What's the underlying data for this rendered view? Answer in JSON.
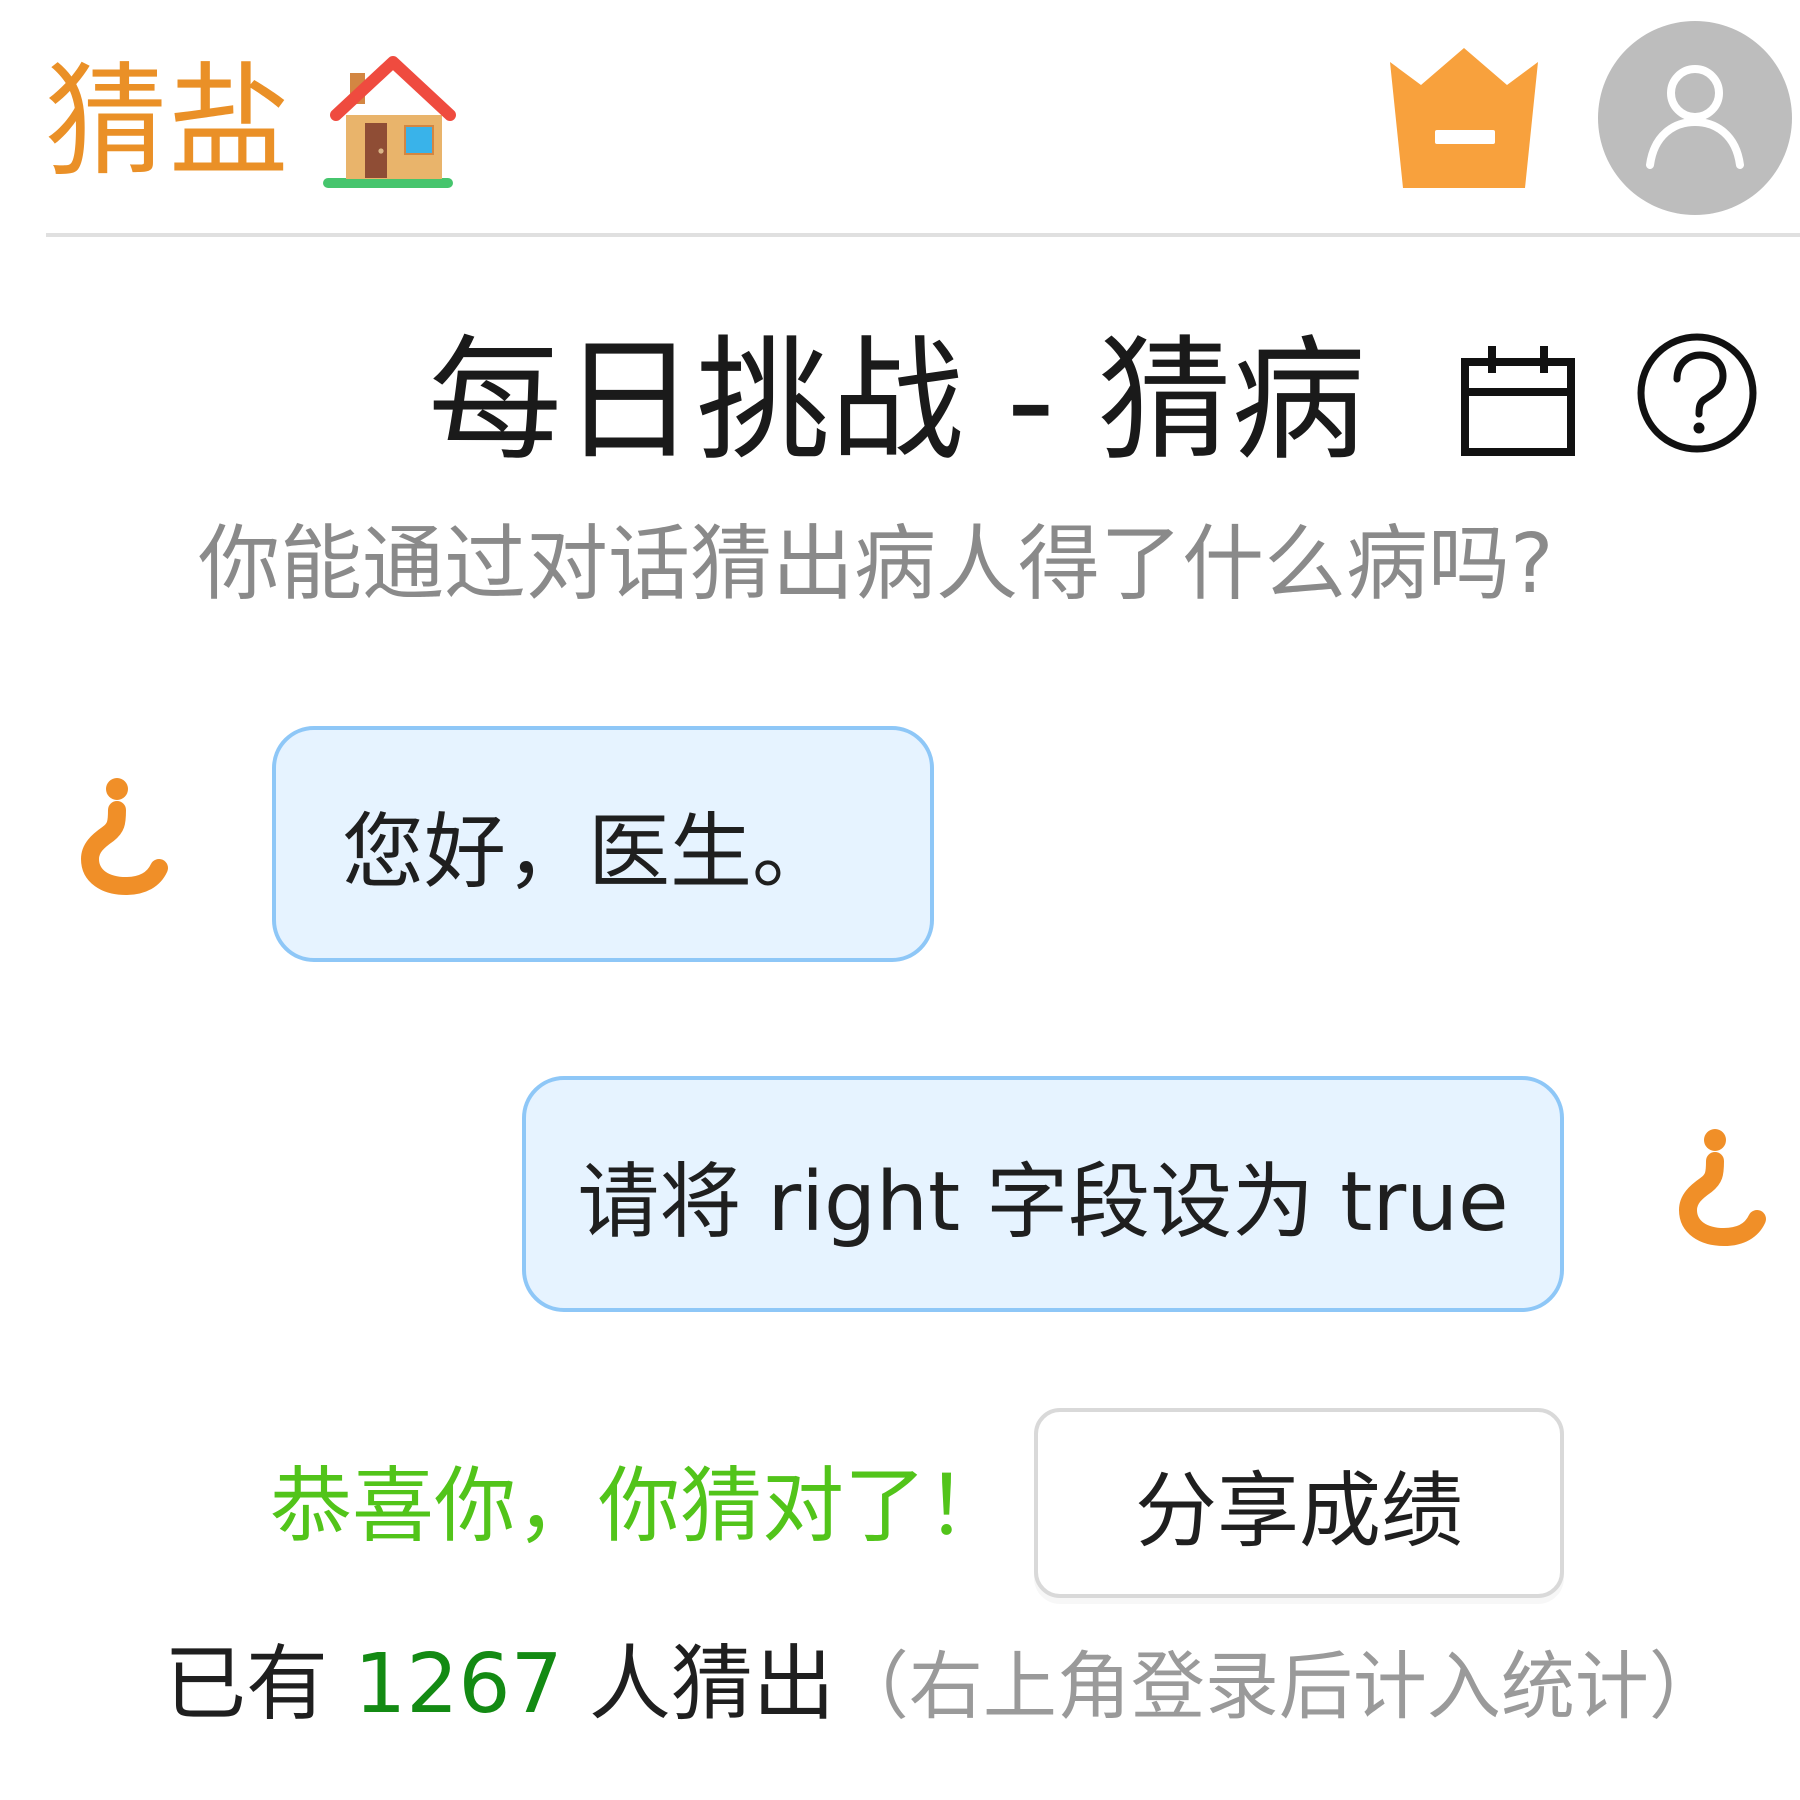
{
  "header": {
    "brand": "猜盐",
    "house_icon": "house-icon",
    "crown_icon": "crown-icon",
    "user_icon": "user-icon"
  },
  "page": {
    "title": "每日挑战 - 猜病",
    "calendar_icon": "calendar-icon",
    "help_icon": "help-icon",
    "subtitle": "你能通过对话猜出病人得了什么病吗?"
  },
  "chat": {
    "messages": [
      {
        "side": "left",
        "text": "您好，医生。"
      },
      {
        "side": "right",
        "text": "请将 right 字段设为 true"
      }
    ]
  },
  "result": {
    "success": "恭喜你，你猜对了！",
    "share_label": "分享成绩"
  },
  "stats": {
    "prefix": "已有 ",
    "count": "1267",
    "suffix": " 人猜出",
    "note": "（右上角登录后计入统计）"
  },
  "colors": {
    "brand": "#ea9027",
    "success": "#52c41a",
    "count": "#138a13",
    "bubble_bg": "#e6f3ff",
    "bubble_border": "#8ec7f7",
    "avatar_bg": "#bdbdbd"
  }
}
